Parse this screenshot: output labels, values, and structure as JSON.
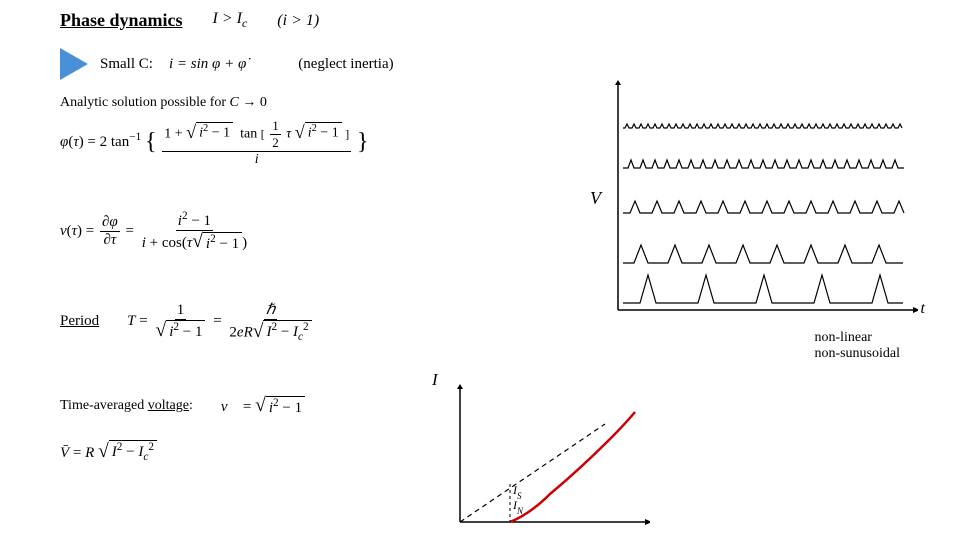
{
  "title": "Phase dynamics",
  "condition1": "I > I_c",
  "condition2": "(i > 1)",
  "smallC": "Small C:",
  "smallCFormula": "i = sin φ + φ̇",
  "neglectInertia": "(neglect inertia)",
  "analyticText": "Analytic solution possible for C → 0",
  "periodLabel": "Period",
  "timeAvgLabel": "Time-averaged voltage:",
  "nonlinear1": "non-linear",
  "nonlinear2": "non-sunusoidal",
  "vLabel": "V",
  "tLabel": "t",
  "iLabel": "I",
  "isLabel": "I_S",
  "inLabel": "I_N"
}
